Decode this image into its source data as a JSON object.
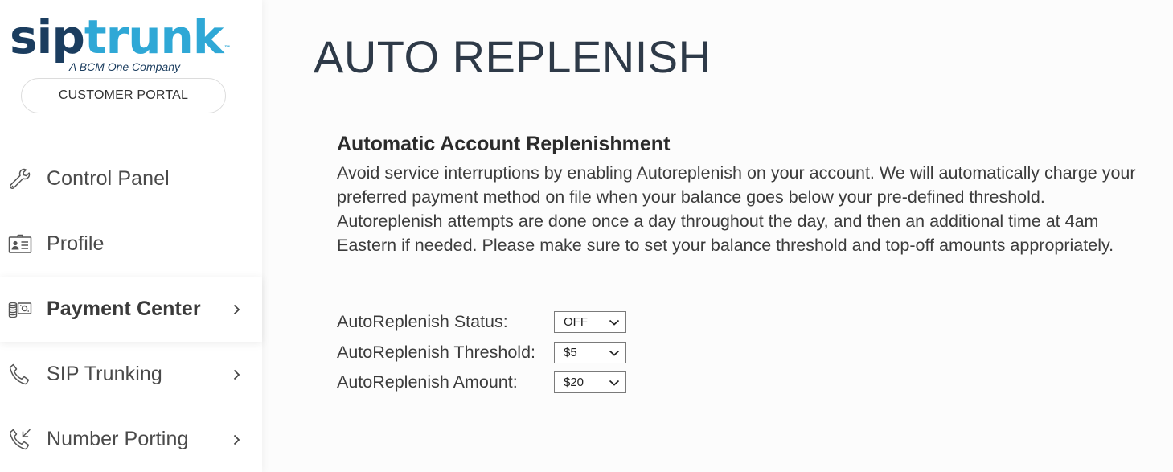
{
  "brand": {
    "name_part1": "sip",
    "name_part2": "trunk",
    "trademark": "™",
    "tagline": "A BCM One Company",
    "colors": {
      "dark": "#1b3d5f",
      "light": "#2fa8d6"
    }
  },
  "sidebar": {
    "portal_button": "CUSTOMER PORTAL",
    "items": [
      {
        "label": "Control Panel",
        "icon": "wrench-icon",
        "active": false,
        "has_chevron": false
      },
      {
        "label": "Profile",
        "icon": "id-card-icon",
        "active": false,
        "has_chevron": false
      },
      {
        "label": "Payment Center",
        "icon": "payment-icon",
        "active": true,
        "has_chevron": true
      },
      {
        "label": "SIP Trunking",
        "icon": "phone-icon",
        "active": false,
        "has_chevron": true
      },
      {
        "label": "Number Porting",
        "icon": "phone-incoming-icon",
        "active": false,
        "has_chevron": true
      }
    ]
  },
  "main": {
    "title": "AUTO REPLENISH",
    "section": {
      "heading": "Automatic Account Replenishment",
      "description": "Avoid service interruptions by enabling Autoreplenish on your account. We will automatically charge your preferred payment method on file when your balance goes below your pre-defined threshold. Autoreplenish attempts are done once a day throughout the day, and then an additional time at 4am Eastern if needed. Please make sure to set your balance threshold and top-off amounts appropriately."
    },
    "form": {
      "status": {
        "label": "AutoReplenish Status:",
        "value": "OFF"
      },
      "threshold": {
        "label": "AutoReplenish Threshold:",
        "value": "$5"
      },
      "amount": {
        "label": "AutoReplenish Amount:",
        "value": "$20"
      }
    }
  }
}
